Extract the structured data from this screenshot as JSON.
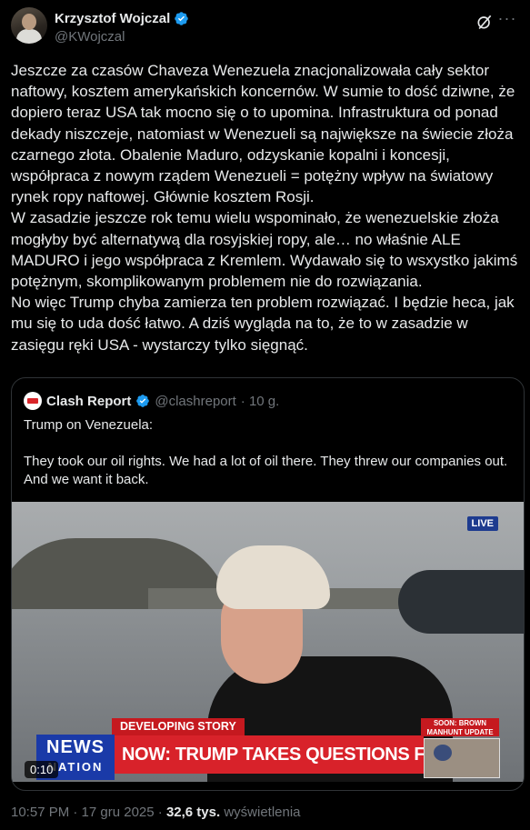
{
  "author": {
    "name": "Krzysztof Wojczal",
    "handle": "@KWojczal"
  },
  "tweet": {
    "text": "Jeszcze za czasów Chaveza Wenezuela znacjonalizowała cały sektor naftowy, kosztem amerykańskich koncernów. W sumie to dość dziwne, że dopiero teraz USA tak mocno się o to upomina. Infrastruktura od ponad dekady niszczeje, natomiast w Wenezueli są największe na świecie złoża czarnego złota. Obalenie Maduro, odzyskanie kopalni i koncesji, współpraca z nowym rządem Wenezueli = potężny wpływ na światowy rynek ropy naftowej. Głównie kosztem Rosji.\nW zasadzie jeszcze rok temu wielu wspominało, że wenezuelskie złoża mogłyby być alternatywą dla rosyjskiej ropy, ale… no właśnie ALE MADURO i jego współpraca z Kremlem. Wydawało się to wsxystko jakimś potężnym, skomplikowanym problemem nie do rozwiązania.\nNo więc Trump chyba zamierza ten problem rozwiązać. I będzie heca, jak mu się to uda dość łatwo. A dziś wygląda na to, że to w zasadzie w zasięgu ręki USA - wystarczy tylko sięgnąć."
  },
  "quote": {
    "name": "Clash Report",
    "handle": "@clashreport",
    "time": "· 10 g.",
    "text": "Trump on Venezuela:\n\nThey took our oil rights. We had a lot of oil there. They threw our companies out. And we want it back.",
    "video": {
      "live_badge": "LIVE",
      "developing": "DEVELOPING STORY",
      "logo_line1": "NEWS",
      "logo_line2": "NATION",
      "headline": "NOW: TRUMP TAKES QUESTIONS FROM REPORTERS",
      "soon_line1": "SOON: BROWN",
      "soon_line2": "MANHUNT UPDATE",
      "timecode": "0:10"
    }
  },
  "meta": {
    "datetime": "10:57 PM · 17 gru 2025 · ",
    "views_count": "32,6 tys.",
    "views_label": " wyświetlenia"
  },
  "colors": {
    "background": "#000000",
    "text": "#e7e9ea",
    "muted": "#71767b",
    "verified": "#1d9bf0",
    "border": "#2f3336"
  },
  "icons": [
    "verified-badge-icon",
    "grok-icon",
    "more-icon"
  ]
}
